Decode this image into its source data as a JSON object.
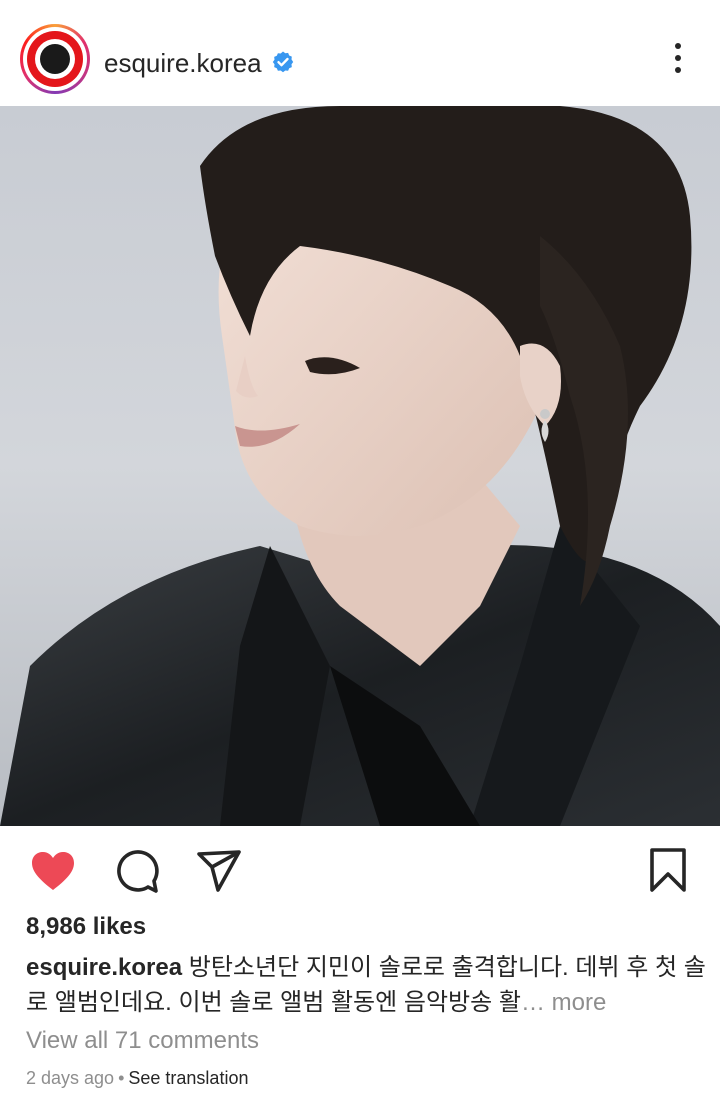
{
  "post": {
    "username": "esquire.korea",
    "likes": "8,986 likes",
    "caption_user": "esquire.korea",
    "caption_text": "방탄소년단 지민이 솔로로 출격합니다. 데뷔 후 첫 솔로 앨범인데요. 이번 솔로 앨범 활동엔 음악방송 활",
    "caption_more": "… more",
    "view_comments": "View all 71 comments",
    "time_ago": "2 days ago",
    "meta_separator": "•",
    "translate": "See translation"
  },
  "icons": {
    "header": [
      "verified-badge-icon",
      "more-options-icon"
    ],
    "actions": [
      "heart-icon",
      "comment-icon",
      "share-icon",
      "save-icon"
    ]
  },
  "colors": {
    "like_red": "#ed4956",
    "verified_blue": "#3897f0",
    "text": "#262626",
    "secondary_text": "#8e8e8e"
  }
}
